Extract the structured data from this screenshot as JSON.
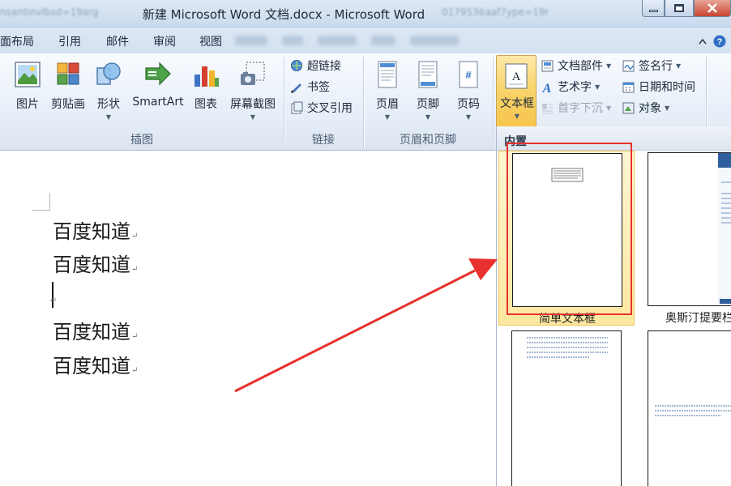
{
  "window": {
    "title": "新建 Microsoft Word 文档.docx  -  Microsoft Word",
    "blurred_left_text": "nsantinvlbsd=19arg",
    "blurred_right_text": "0179536aaf7ype=19r"
  },
  "tabs": [
    "面布局",
    "引用",
    "邮件",
    "审阅",
    "视图"
  ],
  "ribbon": {
    "groups": {
      "illustrations": {
        "label": "插图",
        "buttons": [
          "图片",
          "剪贴画",
          "形状",
          "SmartArt",
          "图表",
          "屏幕截图"
        ]
      },
      "links": {
        "label": "链接",
        "buttons": [
          "超链接",
          "书签",
          "交叉引用"
        ]
      },
      "header_footer": {
        "label": "页眉和页脚",
        "buttons": [
          "页眉",
          "页脚",
          "页码"
        ]
      },
      "text": {
        "textbox": "文本框",
        "doc_parts": "文档部件",
        "wordart": "艺术字",
        "dropcap": "首字下沉",
        "signature": "签名行",
        "datetime": "日期和时间",
        "object": "对象"
      }
    }
  },
  "document": {
    "lines": [
      "百度知道",
      "百度知道",
      "",
      "百度知道",
      "百度知道"
    ]
  },
  "gallery": {
    "header": "内置",
    "items": [
      "简单文本框",
      "奥斯汀提要栏"
    ]
  },
  "colors": {
    "highlight": "#f9d56d",
    "annotation_red": "#e8312e",
    "ribbon_blue": "#dce7f4"
  }
}
